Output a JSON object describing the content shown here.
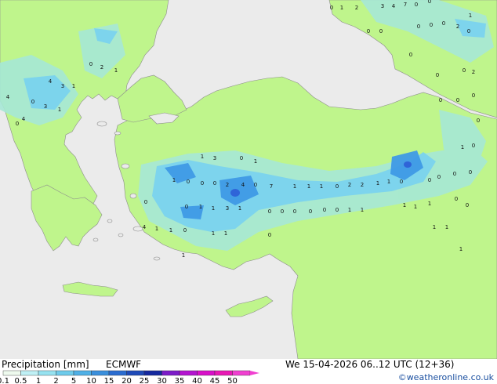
{
  "title": {
    "product": "Precipitation [mm]",
    "model": "ECMWF",
    "valid": "We 15-04-2026 06..12 UTC (12+36)"
  },
  "credit": "©weatheronline.co.uk",
  "legend": {
    "labels": [
      "0.1",
      "0.5",
      "1",
      "2",
      "5",
      "10",
      "15",
      "20",
      "25",
      "30",
      "35",
      "40",
      "45",
      "50"
    ],
    "colors": [
      "#eefaee",
      "#bff0f5",
      "#96e2f0",
      "#6ecbeb",
      "#4fb0e6",
      "#3a8fdc",
      "#2a6cd0",
      "#1f4ab8",
      "#14289e",
      "#7c1bc8",
      "#b414d0",
      "#d810c8",
      "#e818b4",
      "#f040d0"
    ]
  },
  "colors": {
    "sea": "#ebebeb",
    "land": "#bff58c",
    "light_rain": "#a6e8d6",
    "moderate_rain": "#78d2f0",
    "heavy_rain": "#3f9ae6",
    "very_heavy": "#2f64d8",
    "coastline": "#8c8c8c"
  },
  "values": [
    "0",
    "1",
    "2",
    "3",
    "4",
    "7",
    "0",
    "0",
    "1",
    "0",
    "0",
    "0",
    "2",
    "0",
    "0",
    "0",
    "0",
    "0",
    "0",
    "2",
    "0",
    "0",
    "0",
    "0",
    "1",
    "0",
    "0",
    "0",
    "0",
    "0",
    "0",
    "0",
    "1",
    "1",
    "1",
    "1",
    "1",
    "1",
    "0",
    "2",
    "1",
    "4",
    "3",
    "1",
    "0",
    "3",
    "1",
    "0",
    "4",
    "4",
    "1",
    "3",
    "0",
    "1",
    "1",
    "0",
    "0",
    "0",
    "2",
    "4",
    "0",
    "7",
    "1",
    "1",
    "1",
    "0",
    "2",
    "2",
    "1",
    "1",
    "0",
    "0",
    "0",
    "1",
    "1",
    "3",
    "1",
    "0",
    "0",
    "0",
    "0",
    "0",
    "0",
    "1",
    "1",
    "4",
    "1",
    "1",
    "0",
    "1",
    "1",
    "0",
    "1",
    "0",
    "0",
    "1",
    "1",
    "1"
  ]
}
